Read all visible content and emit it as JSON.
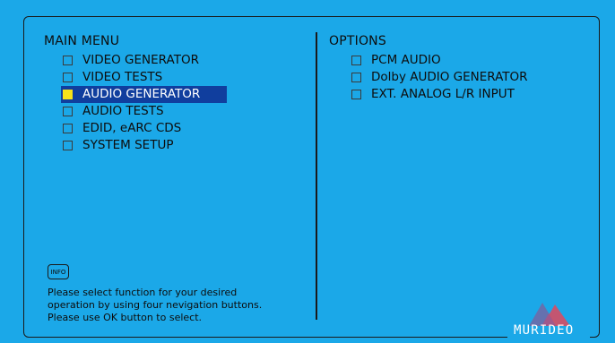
{
  "colors": {
    "background": "#1ba8e8",
    "selection": "#103e9e",
    "selected_marker": "#f6e21a",
    "text": "#0d0d0d"
  },
  "main_menu": {
    "title": "MAIN MENU",
    "selected_index": 2,
    "items": [
      {
        "label": "VIDEO GENERATOR"
      },
      {
        "label": "VIDEO TESTS"
      },
      {
        "label": "AUDIO GENERATOR"
      },
      {
        "label": "AUDIO TESTS"
      },
      {
        "label": "EDID, eARC CDS"
      },
      {
        "label": "SYSTEM SETUP"
      }
    ]
  },
  "options": {
    "title": "OPTIONS",
    "items": [
      {
        "label": "PCM AUDIO"
      },
      {
        "label": "Dolby AUDIO GENERATOR"
      },
      {
        "label": "EXT. ANALOG L/R INPUT"
      }
    ]
  },
  "info": {
    "icon_label": "INFO",
    "help_lines": [
      "Please select function for your desired",
      "operation by using four nevigation buttons.",
      "Please use OK button to select."
    ]
  },
  "brand": {
    "name": "MURIDEO"
  }
}
